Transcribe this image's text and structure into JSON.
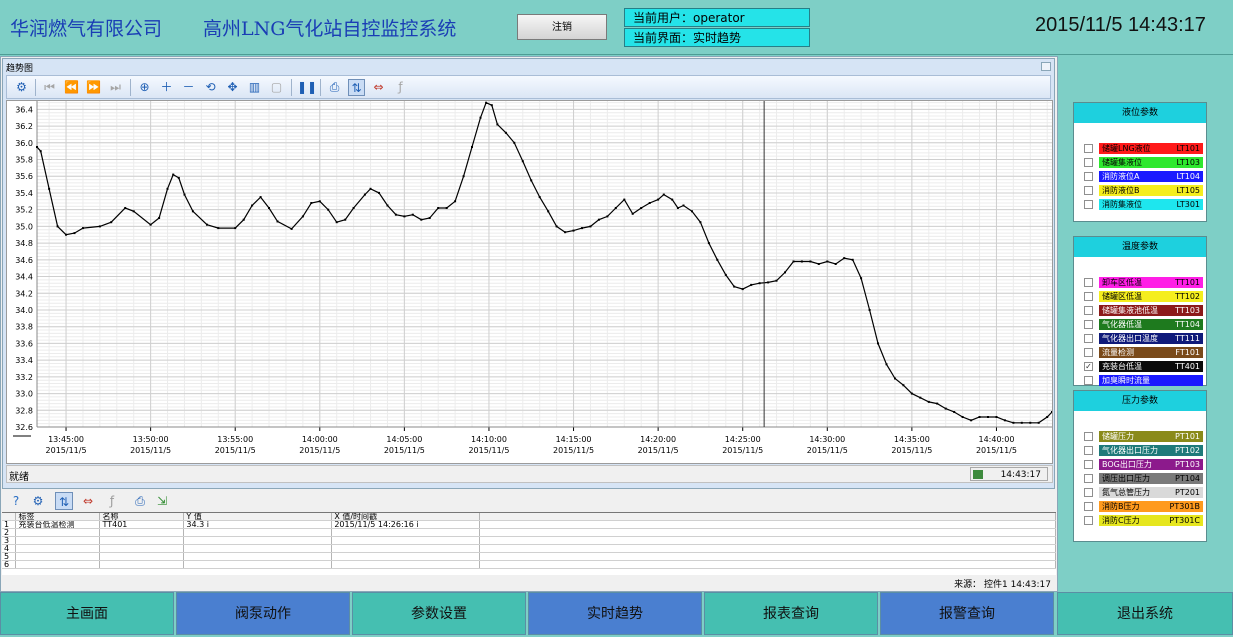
{
  "header": {
    "company": "华润燃气有限公司",
    "system": "高州LNG气化站自控监控系统",
    "logout_label": "注销",
    "user_label": "当前用户：operator",
    "page_label": "当前界面：实时趋势",
    "datetime": "2015/11/5 14:43:17"
  },
  "trend_window": {
    "title": "趋势图",
    "status": "就绪",
    "status_time": "14:43:17"
  },
  "chart_data": {
    "type": "line",
    "title": "",
    "xlabel": "",
    "ylabel": "",
    "ylim": [
      32.6,
      36.5
    ],
    "yticks": [
      "36.4",
      "36.2",
      "36.0",
      "35.8",
      "35.6",
      "35.4",
      "35.2",
      "35.0",
      "34.8",
      "34.6",
      "34.4",
      "34.2",
      "34.0",
      "33.8",
      "33.6",
      "33.4",
      "33.2",
      "33.0",
      "32.8",
      "32.6"
    ],
    "xticks": [
      {
        "time": "13:45:00",
        "date": "2015/11/5"
      },
      {
        "time": "13:50:00",
        "date": "2015/11/5"
      },
      {
        "time": "13:55:00",
        "date": "2015/11/5"
      },
      {
        "time": "14:00:00",
        "date": "2015/11/5"
      },
      {
        "time": "14:05:00",
        "date": "2015/11/5"
      },
      {
        "time": "14:10:00",
        "date": "2015/11/5"
      },
      {
        "time": "14:15:00",
        "date": "2015/11/5"
      },
      {
        "time": "14:20:00",
        "date": "2015/11/5"
      },
      {
        "time": "14:25:00",
        "date": "2015/11/5"
      },
      {
        "time": "14:30:00",
        "date": "2015/11/5"
      },
      {
        "time": "14:35:00",
        "date": "2015/11/5"
      },
      {
        "time": "14:40:00",
        "date": "2015/11/5"
      }
    ],
    "cursor_time": "14:26:16",
    "grid": true,
    "series": [
      {
        "color": "#000000",
        "points": [
          [
            "13:43:17",
            35.95
          ],
          [
            "13:43:30",
            35.9
          ],
          [
            "13:44:00",
            35.45
          ],
          [
            "13:44:30",
            35.0
          ],
          [
            "13:45:00",
            34.9
          ],
          [
            "13:45:30",
            34.92
          ],
          [
            "13:46:00",
            34.98
          ],
          [
            "13:47:00",
            35.0
          ],
          [
            "13:47:40",
            35.05
          ],
          [
            "13:48:30",
            35.22
          ],
          [
            "13:49:00",
            35.18
          ],
          [
            "13:50:00",
            35.02
          ],
          [
            "13:50:30",
            35.1
          ],
          [
            "13:51:00",
            35.45
          ],
          [
            "13:51:20",
            35.62
          ],
          [
            "13:51:40",
            35.58
          ],
          [
            "13:52:00",
            35.38
          ],
          [
            "13:52:30",
            35.18
          ],
          [
            "13:53:20",
            35.02
          ],
          [
            "13:54:00",
            34.98
          ],
          [
            "13:55:00",
            34.98
          ],
          [
            "13:55:30",
            35.08
          ],
          [
            "13:56:00",
            35.25
          ],
          [
            "13:56:30",
            35.35
          ],
          [
            "13:57:00",
            35.22
          ],
          [
            "13:57:30",
            35.06
          ],
          [
            "13:58:20",
            34.97
          ],
          [
            "13:59:00",
            35.12
          ],
          [
            "13:59:30",
            35.28
          ],
          [
            "14:00:00",
            35.3
          ],
          [
            "14:00:30",
            35.2
          ],
          [
            "14:01:00",
            35.05
          ],
          [
            "14:01:30",
            35.08
          ],
          [
            "14:02:00",
            35.22
          ],
          [
            "14:02:40",
            35.38
          ],
          [
            "14:03:00",
            35.45
          ],
          [
            "14:03:30",
            35.4
          ],
          [
            "14:04:00",
            35.25
          ],
          [
            "14:04:30",
            35.14
          ],
          [
            "14:05:00",
            35.12
          ],
          [
            "14:05:30",
            35.14
          ],
          [
            "14:06:00",
            35.08
          ],
          [
            "14:06:30",
            35.1
          ],
          [
            "14:07:00",
            35.22
          ],
          [
            "14:07:30",
            35.22
          ],
          [
            "14:08:00",
            35.3
          ],
          [
            "14:08:30",
            35.6
          ],
          [
            "14:09:00",
            35.95
          ],
          [
            "14:09:30",
            36.3
          ],
          [
            "14:09:50",
            36.48
          ],
          [
            "14:10:10",
            36.45
          ],
          [
            "14:10:30",
            36.22
          ],
          [
            "14:11:00",
            36.12
          ],
          [
            "14:11:30",
            36.0
          ],
          [
            "14:12:00",
            35.78
          ],
          [
            "14:12:30",
            35.55
          ],
          [
            "14:13:00",
            35.35
          ],
          [
            "14:13:30",
            35.18
          ],
          [
            "14:14:00",
            35.0
          ],
          [
            "14:14:30",
            34.93
          ],
          [
            "14:15:00",
            34.95
          ],
          [
            "14:15:30",
            34.98
          ],
          [
            "14:16:00",
            35.0
          ],
          [
            "14:16:30",
            35.08
          ],
          [
            "14:17:00",
            35.12
          ],
          [
            "14:17:30",
            35.22
          ],
          [
            "14:18:00",
            35.32
          ],
          [
            "14:18:30",
            35.15
          ],
          [
            "14:19:00",
            35.22
          ],
          [
            "14:19:30",
            35.28
          ],
          [
            "14:20:00",
            35.32
          ],
          [
            "14:20:20",
            35.38
          ],
          [
            "14:20:50",
            35.32
          ],
          [
            "14:21:10",
            35.22
          ],
          [
            "14:21:30",
            35.25
          ],
          [
            "14:22:00",
            35.18
          ],
          [
            "14:22:30",
            35.05
          ],
          [
            "14:23:00",
            34.8
          ],
          [
            "14:23:30",
            34.6
          ],
          [
            "14:24:00",
            34.42
          ],
          [
            "14:24:30",
            34.28
          ],
          [
            "14:25:00",
            34.25
          ],
          [
            "14:25:30",
            34.3
          ],
          [
            "14:26:00",
            34.32
          ],
          [
            "14:26:30",
            34.33
          ],
          [
            "14:27:00",
            34.35
          ],
          [
            "14:27:30",
            34.45
          ],
          [
            "14:28:00",
            34.58
          ],
          [
            "14:28:30",
            34.58
          ],
          [
            "14:29:00",
            34.58
          ],
          [
            "14:29:30",
            34.55
          ],
          [
            "14:30:00",
            34.58
          ],
          [
            "14:30:30",
            34.55
          ],
          [
            "14:31:00",
            34.62
          ],
          [
            "14:31:30",
            34.6
          ],
          [
            "14:32:00",
            34.38
          ],
          [
            "14:32:30",
            34.0
          ],
          [
            "14:33:00",
            33.6
          ],
          [
            "14:33:30",
            33.35
          ],
          [
            "14:34:00",
            33.18
          ],
          [
            "14:34:30",
            33.1
          ],
          [
            "14:35:00",
            33.0
          ],
          [
            "14:35:30",
            32.95
          ],
          [
            "14:36:00",
            32.9
          ],
          [
            "14:36:30",
            32.88
          ],
          [
            "14:37:00",
            32.82
          ],
          [
            "14:37:30",
            32.78
          ],
          [
            "14:38:00",
            32.72
          ],
          [
            "14:38:30",
            32.68
          ],
          [
            "14:39:00",
            32.72
          ],
          [
            "14:39:30",
            32.72
          ],
          [
            "14:40:00",
            32.72
          ],
          [
            "14:40:30",
            32.68
          ],
          [
            "14:41:00",
            32.65
          ],
          [
            "14:41:30",
            32.65
          ],
          [
            "14:42:00",
            32.65
          ],
          [
            "14:42:30",
            32.65
          ],
          [
            "14:43:00",
            32.72
          ],
          [
            "14:43:17",
            32.78
          ]
        ]
      }
    ]
  },
  "lower_table": {
    "headers": [
      "标签",
      "名称",
      "Y 值",
      "X 值/时间戳"
    ],
    "rows": [
      {
        "n": "1",
        "label": "充装台低温检测",
        "name": "TT401",
        "y": "34.3 i",
        "x": "2015/11/5 14:26:16 i"
      },
      {
        "n": "2",
        "label": "",
        "name": "",
        "y": "",
        "x": ""
      },
      {
        "n": "3",
        "label": "",
        "name": "",
        "y": "",
        "x": ""
      },
      {
        "n": "4",
        "label": "",
        "name": "",
        "y": "",
        "x": ""
      },
      {
        "n": "5",
        "label": "",
        "name": "",
        "y": "",
        "x": ""
      },
      {
        "n": "6",
        "label": "",
        "name": "",
        "y": "",
        "x": ""
      }
    ],
    "source": "来源： 控件1  14:43:17"
  },
  "groups": [
    {
      "title": "液位参数",
      "items": [
        {
          "name": "储罐LNG液位",
          "code": "LT101",
          "color": "#ff1a1a",
          "text": "#000000",
          "checked": false
        },
        {
          "name": "储罐集液位",
          "code": "LT103",
          "color": "#2ee82e",
          "text": "#000000",
          "checked": false
        },
        {
          "name": "消防液位A",
          "code": "LT104",
          "color": "#1a1aff",
          "text": "#ffffff",
          "checked": false
        },
        {
          "name": "消防液位B",
          "code": "LT105",
          "color": "#f5ee1e",
          "text": "#000000",
          "checked": false
        },
        {
          "name": "消防集液位",
          "code": "LT301",
          "color": "#1ee6ee",
          "text": "#000000",
          "checked": false
        }
      ]
    },
    {
      "title": "温度参数",
      "items": [
        {
          "name": "卸车区低温",
          "code": "TT101",
          "color": "#ff1ee6",
          "text": "#000000",
          "checked": false
        },
        {
          "name": "储罐区低温",
          "code": "TT102",
          "color": "#f5ee1e",
          "text": "#000000",
          "checked": false
        },
        {
          "name": "储罐集液池低温",
          "code": "TT103",
          "color": "#8c1a1a",
          "text": "#ffffff",
          "checked": false
        },
        {
          "name": "气化器低温",
          "code": "TT104",
          "color": "#1e7a1e",
          "text": "#ffffff",
          "checked": false
        },
        {
          "name": "气化器出口温度",
          "code": "TT111",
          "color": "#0f1a7a",
          "text": "#ffffff",
          "checked": false
        },
        {
          "name": "流量检测",
          "code": "FT101",
          "color": "#7a4a1a",
          "text": "#ffffff",
          "checked": false
        },
        {
          "name": "充装台低温",
          "code": "TT401",
          "color": "#0a0a0a",
          "text": "#ffffff",
          "checked": true
        },
        {
          "name": "加臭瞬时流量",
          "code": "",
          "color": "#1a1aff",
          "text": "#ffffff",
          "checked": false
        }
      ]
    },
    {
      "title": "压力参数",
      "items": [
        {
          "name": "储罐压力",
          "code": "PT101",
          "color": "#8a8a1a",
          "text": "#ffffff",
          "checked": false
        },
        {
          "name": "气化器出口压力",
          "code": "PT102",
          "color": "#1e7a7a",
          "text": "#ffffff",
          "checked": false
        },
        {
          "name": "BOG出口压力",
          "code": "PT103",
          "color": "#8c1a8c",
          "text": "#ffffff",
          "checked": false
        },
        {
          "name": "调压出口压力",
          "code": "PT104",
          "color": "#7a7a7a",
          "text": "#000000",
          "checked": false
        },
        {
          "name": "氮气总管压力",
          "code": "PT201",
          "color": "#d9d9d9",
          "text": "#000000",
          "checked": false
        },
        {
          "name": "消防B压力",
          "code": "PT301B",
          "color": "#ff9a1e",
          "text": "#000000",
          "checked": false
        },
        {
          "name": "消防C压力",
          "code": "PT301C",
          "color": "#e6e61e",
          "text": "#000000",
          "checked": false
        }
      ]
    }
  ],
  "nav": [
    "主画面",
    "阀泵动作",
    "参数设置",
    "实时趋势",
    "报表查询",
    "报警查询",
    "退出系统"
  ]
}
